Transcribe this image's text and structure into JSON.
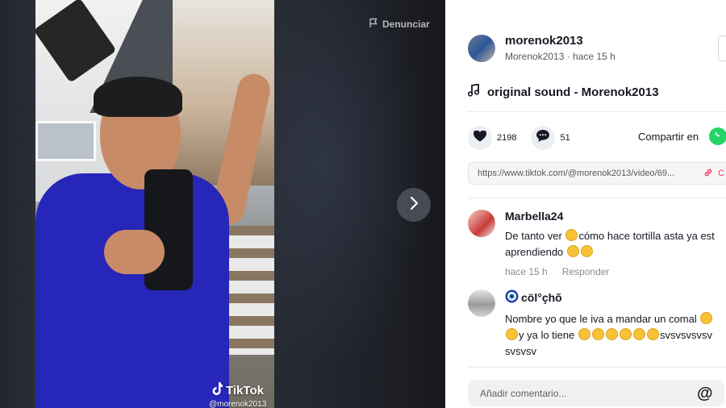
{
  "video": {
    "report_label": "Denunciar",
    "watermark": "TikTok",
    "watermark_user": "@morenok2013",
    "next_icon": "chevron-right-icon"
  },
  "author": {
    "name": "morenok2013",
    "subtitle": "Morenok2013 · hace 15 h"
  },
  "sound": {
    "label": "original sound - Morenok2013"
  },
  "stats": {
    "likes": "2198",
    "comments": "51",
    "share_label": "Compartir en"
  },
  "link": {
    "url": "https://www.tiktok.com/@morenok2013/video/69...",
    "copy_label": "C"
  },
  "comments": [
    {
      "name": "Marbella24",
      "text_parts": [
        "De tanto ver ",
        "cómo hace tortilla asta ya est",
        "aprendiendo"
      ],
      "time": "hace 15 h",
      "reply": "Responder"
    },
    {
      "name": "cöl°çhõ",
      "text_line1": "Nombre yo que le iva a mandar un comal",
      "text_line2_suffix": "y ya lo tiene",
      "text_line2_tail": "svsvsvsvsv",
      "text_line3": "svsvsv"
    }
  ],
  "add_comment": {
    "placeholder": "Añadir comentario..."
  },
  "colors": {
    "accent": "#fe2c55",
    "whatsapp": "#25d366",
    "text": "#161823"
  }
}
